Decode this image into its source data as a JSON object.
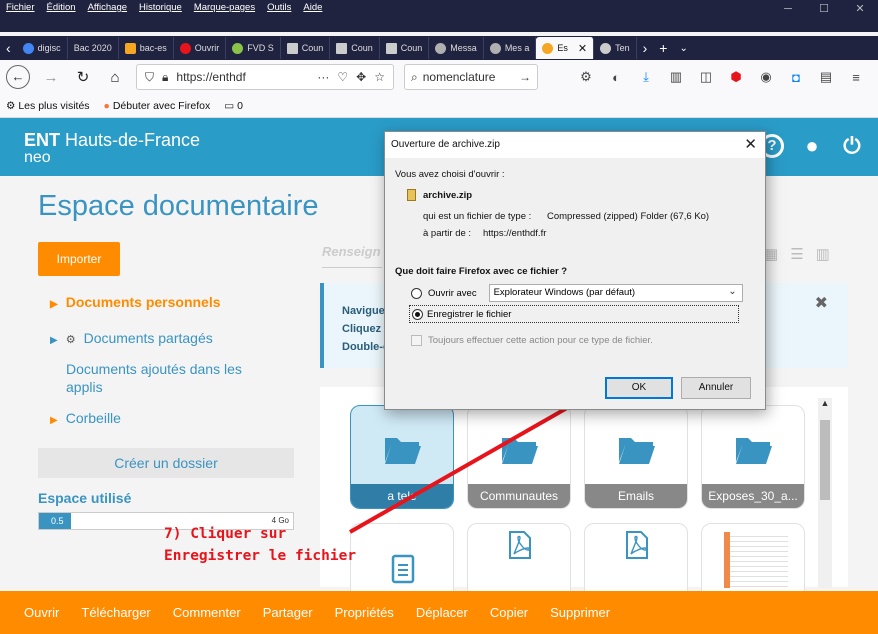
{
  "browser": {
    "menu": [
      "Fichier",
      "Édition",
      "Affichage",
      "Historique",
      "Marque-pages",
      "Outils",
      "Aide"
    ],
    "tabs": [
      {
        "label": "digisc",
        "favicon_color": "#4285f4"
      },
      {
        "label": "Bac 2020",
        "favicon_color": "#3a3f66"
      },
      {
        "label": "bac-es",
        "favicon_color": "#f5a623"
      },
      {
        "label": "Ouvrir",
        "favicon_color": "#e8141b"
      },
      {
        "label": "FVD S",
        "favicon_color": "#8bc34a"
      },
      {
        "label": "Coun",
        "favicon_color": "#cccccc"
      },
      {
        "label": "Coun",
        "favicon_color": "#cccccc"
      },
      {
        "label": "Coun",
        "favicon_color": "#cccccc"
      },
      {
        "label": "Messa",
        "favicon_color": "#b0b0b0"
      },
      {
        "label": "Mes a",
        "favicon_color": "#b0b0b0"
      },
      {
        "label": "Es",
        "favicon_color": "#f5a623"
      },
      {
        "label": "Ten",
        "favicon_color": "#cccccc"
      }
    ],
    "url": "https://enthdf",
    "search_value": "nomenclature",
    "bookmarks": [
      "Les plus visités",
      "Débuter avec Firefox",
      "0"
    ]
  },
  "ent": {
    "logo_bold": "ENT",
    "logo_rest": "Hauts-de-France",
    "logo_sub": "neo",
    "page_title": "Espace documentaire",
    "import_button": "Importer",
    "tree": {
      "personal": "Documents personnels",
      "shared": "Documents partagés",
      "apps": "Documents ajoutés dans les applis",
      "trash": "Corbeille"
    },
    "create_folder": "Créer un dossier",
    "space_label": "Espace utilisé",
    "space_used": "0.5",
    "space_max": "4 Go",
    "space_fraction": 0.125,
    "search_placeholder": "Renseign",
    "info_lines": [
      "Navigue",
      "Cliquez",
      "Double-c"
    ],
    "folders": [
      "a tele",
      "Communautes",
      "Emails",
      "Exposes_30_a..."
    ],
    "actions": [
      "Ouvrir",
      "Télécharger",
      "Commenter",
      "Partager",
      "Propriétés",
      "Déplacer",
      "Copier",
      "Supprimer"
    ]
  },
  "dialog": {
    "title": "Ouverture de archive.zip",
    "intro": "Vous avez choisi d'ouvrir :",
    "file_name": "archive.zip",
    "type_label": "qui est un fichier de type :",
    "type_value": "Compressed (zipped) Folder (67,6 Ko)",
    "from_label": "à partir de :",
    "from_value": "https://enthdf.fr",
    "question": "Que doit faire Firefox avec ce fichier ?",
    "open_with": "Ouvrir avec",
    "open_with_app": "Explorateur Windows (par défaut)",
    "save_file": "Enregistrer le fichier",
    "always": "Toujours effectuer cette action pour ce type de fichier.",
    "ok": "OK",
    "cancel": "Annuler"
  },
  "annotation": {
    "line1": "7) Cliquer sur",
    "line2": "Enregistrer le fichier"
  }
}
